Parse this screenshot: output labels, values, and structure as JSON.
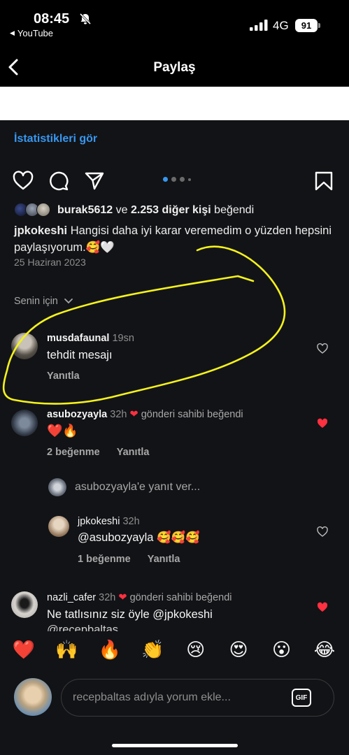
{
  "status": {
    "time": "08:45",
    "back_app": "YouTube",
    "network": "4G",
    "battery": "91"
  },
  "header": {
    "title": "Paylaş"
  },
  "post": {
    "stats_link": "İstatistikleri gör",
    "likes": {
      "user": "burak5612",
      "conj": "ve",
      "others": "2.253 diğer kişi",
      "suffix": "beğendi"
    },
    "caption": {
      "user": "jpkokeshi",
      "text": "Hangisi daha iyi karar veremedim o yüzden hepsini paylaşıyorum.🥰🤍"
    },
    "date": "25 Haziran 2023",
    "carousel": {
      "count": 4,
      "active": 1
    }
  },
  "comments_sort": "Senin için",
  "comments": [
    {
      "user": "musdafaunal",
      "time": "19sn",
      "text": "tehdit mesajı",
      "reply_label": "Yanıtla"
    },
    {
      "user": "asubozyayla",
      "time": "32h",
      "liked_by_author": "gönderi sahibi beğendi",
      "text": "❤️🔥",
      "likes": "2 beğenme",
      "reply_label": "Yanıtla",
      "view_replies": "asubozyayla'e yanıt ver...",
      "reply": {
        "user": "jpkokeshi",
        "time": "32h",
        "text": "@asubozyayla 🥰🥰🥰",
        "likes": "1 beğenme",
        "reply_label": "Yanıtla"
      }
    },
    {
      "user": "nazli_cafer",
      "time": "32h",
      "liked_by_author": "gönderi sahibi beğendi",
      "text": "Ne tatlısınız siz öyle @jpkokeshi",
      "text_cut": "@recepbaltas"
    }
  ],
  "quick_emojis": [
    "❤️",
    "🙌",
    "🔥",
    "👏",
    "😢",
    "😍",
    "😮",
    "😂"
  ],
  "composer": {
    "placeholder": "recepbaltas adıyla yorum ekle...",
    "gif": "GIF"
  },
  "colors": {
    "accent": "#3797f0",
    "liked": "#ff3040",
    "annotation": "#f4f21c",
    "panel": "#121316"
  }
}
